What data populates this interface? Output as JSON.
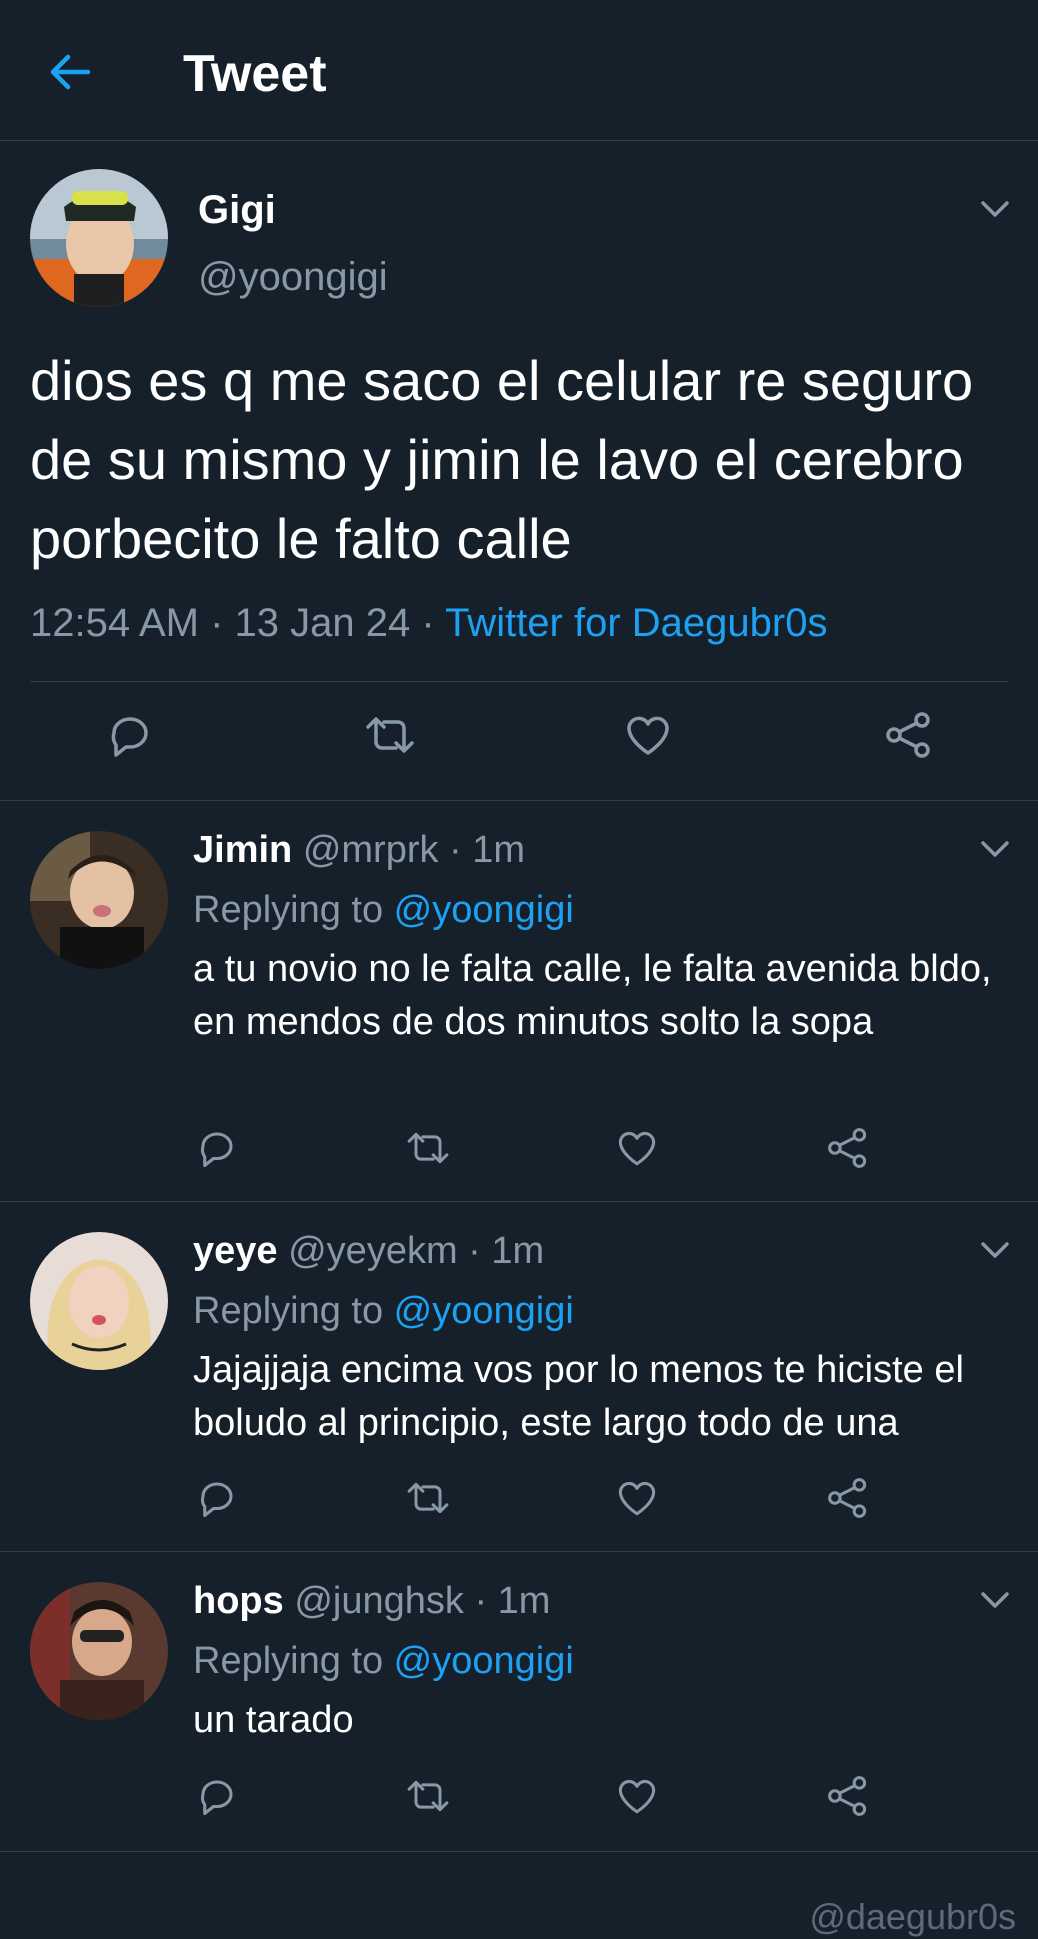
{
  "header": {
    "title": "Tweet"
  },
  "tweet": {
    "name": "Gigi",
    "handle": "@yoongigi",
    "text": "dios es q me saco el celular re seguro de su mismo y jimin le lavo el cerebro porbecito le falto calle",
    "time": "12:54 AM · 13 Jan 24 · ",
    "source": "Twitter for Daegubr0s"
  },
  "replies": [
    {
      "name": "Jimin",
      "handle": "@mrprk · 1m",
      "replying_prefix": "Replying to ",
      "replying_to": "@yoongigi",
      "text": "a tu novio no le falta calle, le falta avenida bldo, en mendos de dos minutos solto la sopa"
    },
    {
      "name": "yeye",
      "handle": "@yeyekm · 1m",
      "replying_prefix": "Replying to ",
      "replying_to": "@yoongigi",
      "text": "Jajajjaja encima vos por lo menos te hiciste el boludo al principio, este largo todo de una"
    },
    {
      "name": "hops",
      "handle": "@junghsk · 1m",
      "replying_prefix": "Replying to ",
      "replying_to": "@yoongigi",
      "text": "un tarado"
    }
  ],
  "watermark": "@daegubr0s",
  "colors": {
    "background": "#15202b",
    "accent": "#1da1f2",
    "muted": "#8899a6",
    "divider": "#2f3d4b"
  }
}
